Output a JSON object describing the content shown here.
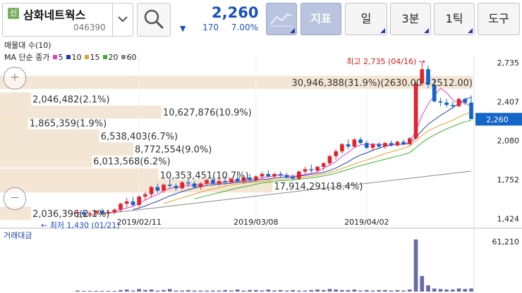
{
  "stock": {
    "badge": "신",
    "name": "삼화네트웍스",
    "code": "046390",
    "price": "2,260",
    "change_arrow": "▼",
    "change": "170",
    "change_pct": "7.00%"
  },
  "toolbar": {
    "indicator": "지표",
    "period": "일",
    "min": "3분",
    "tick": "1틱",
    "tools": "도구"
  },
  "legend": {
    "volume_profile": "매물대 수(10)",
    "ma_title": "MA 단순 종가",
    "ma": [
      {
        "label": "5",
        "color": "#e040c8"
      },
      {
        "label": "10",
        "color": "#1f3ea0"
      },
      {
        "label": "15",
        "color": "#e8a030"
      },
      {
        "label": "20",
        "color": "#3ab030"
      },
      {
        "label": "60",
        "color": "#888888"
      }
    ]
  },
  "colors": {
    "up": "#e0242c",
    "down": "#1565c8",
    "profile": "#f3e3cf",
    "volume": "#6a6aa8"
  },
  "chart_data": {
    "type": "candlestick",
    "y_ticks": [
      "2,735",
      "2,407",
      "2,080",
      "1,752",
      "1,424"
    ],
    "y_tick_values": [
      2735,
      2407,
      2080,
      1752,
      1424
    ],
    "ylim": [
      1380,
      2800
    ],
    "x_ticks": [
      {
        "label": "2019/02/11",
        "index": 10
      },
      {
        "label": "2019/03/08",
        "index": 29
      },
      {
        "label": "2019/04/02",
        "index": 47
      }
    ],
    "current_price_label": "2,260",
    "current_price": 2260,
    "max_annotation": "최고 2,735 (04/16) →",
    "max_value": 2735,
    "max_index": 57,
    "min_annotation": "← 최저 1,430 (01/21)",
    "min_value": 1430,
    "min_index": 0,
    "volume_max_label": "61,210",
    "volume_max": 61210,
    "volume_profile": [
      {
        "label": "30,946,388(31.9%)(2630.00 - 2512.00)",
        "price": 2570,
        "pct": 31.9
      },
      {
        "label": "2,046,482(2.1%)",
        "price": 2430,
        "pct": 2.1
      },
      {
        "label": "10,627,876(10.9%)",
        "price": 2320,
        "pct": 10.9
      },
      {
        "label": "1,865,359(1.9%)",
        "price": 2230,
        "pct": 1.9
      },
      {
        "label": "6,538,403(6.7%)",
        "price": 2120,
        "pct": 6.7
      },
      {
        "label": "8,772,554(9.0%)",
        "price": 2010,
        "pct": 9.0
      },
      {
        "label": "6,013,568(6.2%)",
        "price": 1910,
        "pct": 6.2
      },
      {
        "label": "10,353,451(10.7%)",
        "price": 1790,
        "pct": 10.7
      },
      {
        "label": "17,914,291(18.4%)",
        "price": 1700,
        "pct": 18.4
      },
      {
        "label": "2,036,396(2.1%)",
        "price": 1470,
        "pct": 2.1
      }
    ],
    "candles": [
      [
        1470,
        1500,
        1430,
        1480
      ],
      [
        1480,
        1500,
        1450,
        1460
      ],
      [
        1460,
        1490,
        1440,
        1470
      ],
      [
        1470,
        1500,
        1450,
        1490
      ],
      [
        1490,
        1510,
        1460,
        1470
      ],
      [
        1470,
        1500,
        1450,
        1480
      ],
      [
        1480,
        1510,
        1460,
        1500
      ],
      [
        1500,
        1560,
        1480,
        1550
      ],
      [
        1550,
        1600,
        1520,
        1570
      ],
      [
        1570,
        1610,
        1530,
        1540
      ],
      [
        1540,
        1620,
        1520,
        1610
      ],
      [
        1610,
        1650,
        1580,
        1630
      ],
      [
        1630,
        1700,
        1600,
        1690
      ],
      [
        1690,
        1720,
        1640,
        1660
      ],
      [
        1660,
        1720,
        1640,
        1710
      ],
      [
        1710,
        1760,
        1680,
        1700
      ],
      [
        1700,
        1720,
        1660,
        1680
      ],
      [
        1680,
        1740,
        1670,
        1730
      ],
      [
        1730,
        1760,
        1690,
        1720
      ],
      [
        1720,
        1740,
        1680,
        1690
      ],
      [
        1690,
        1730,
        1670,
        1720
      ],
      [
        1720,
        1760,
        1700,
        1750
      ],
      [
        1750,
        1770,
        1710,
        1720
      ],
      [
        1720,
        1760,
        1700,
        1740
      ],
      [
        1740,
        1780,
        1710,
        1730
      ],
      [
        1730,
        1770,
        1720,
        1760
      ],
      [
        1760,
        1790,
        1730,
        1740
      ],
      [
        1740,
        1780,
        1720,
        1770
      ],
      [
        1770,
        1800,
        1740,
        1750
      ],
      [
        1750,
        1790,
        1730,
        1780
      ],
      [
        1780,
        1820,
        1760,
        1800
      ],
      [
        1800,
        1830,
        1770,
        1780
      ],
      [
        1780,
        1810,
        1760,
        1800
      ],
      [
        1800,
        1820,
        1770,
        1790
      ],
      [
        1790,
        1810,
        1760,
        1770
      ],
      [
        1770,
        1800,
        1750,
        1760
      ],
      [
        1760,
        1830,
        1750,
        1820
      ],
      [
        1820,
        1860,
        1800,
        1840
      ],
      [
        1840,
        1880,
        1810,
        1830
      ],
      [
        1830,
        1870,
        1810,
        1860
      ],
      [
        1860,
        1900,
        1830,
        1890
      ],
      [
        1890,
        1960,
        1870,
        1950
      ],
      [
        1950,
        2010,
        1920,
        1990
      ],
      [
        1990,
        2060,
        1970,
        2050
      ],
      [
        2050,
        2090,
        2010,
        2030
      ],
      [
        2030,
        2100,
        2020,
        2090
      ],
      [
        2090,
        2110,
        2050,
        2060
      ],
      [
        2060,
        2080,
        2010,
        2020
      ],
      [
        2020,
        2060,
        2000,
        2050
      ],
      [
        2050,
        2070,
        2020,
        2030
      ],
      [
        2030,
        2070,
        2010,
        2060
      ],
      [
        2060,
        2080,
        2030,
        2040
      ],
      [
        2040,
        2080,
        2030,
        2070
      ],
      [
        2070,
        2090,
        2040,
        2050
      ],
      [
        2050,
        2110,
        2040,
        2100
      ],
      [
        2100,
        2570,
        2090,
        2560
      ],
      [
        2560,
        2735,
        2540,
        2680
      ],
      [
        2680,
        2710,
        2520,
        2550
      ],
      [
        2550,
        2600,
        2400,
        2410
      ],
      [
        2410,
        2440,
        2370,
        2400
      ],
      [
        2400,
        2430,
        2360,
        2380
      ],
      [
        2380,
        2410,
        2350,
        2370
      ],
      [
        2370,
        2440,
        2360,
        2430
      ],
      [
        2430,
        2440,
        2380,
        2400
      ],
      [
        2400,
        2460,
        2300,
        2260
      ]
    ],
    "volumes": [
      2,
      1,
      1,
      1,
      1,
      1,
      1,
      3,
      4,
      2,
      5,
      3,
      4,
      2,
      3,
      5,
      2,
      2,
      3,
      2,
      2,
      2,
      2,
      2,
      3,
      2,
      4,
      2,
      3,
      3,
      2,
      4,
      2,
      3,
      2,
      3,
      2,
      2,
      3,
      4,
      3,
      5,
      4,
      3,
      3,
      4,
      2,
      3,
      2,
      3,
      3,
      2,
      3,
      2,
      4,
      100,
      30,
      12,
      6,
      5,
      4,
      4,
      6,
      5,
      6
    ]
  }
}
